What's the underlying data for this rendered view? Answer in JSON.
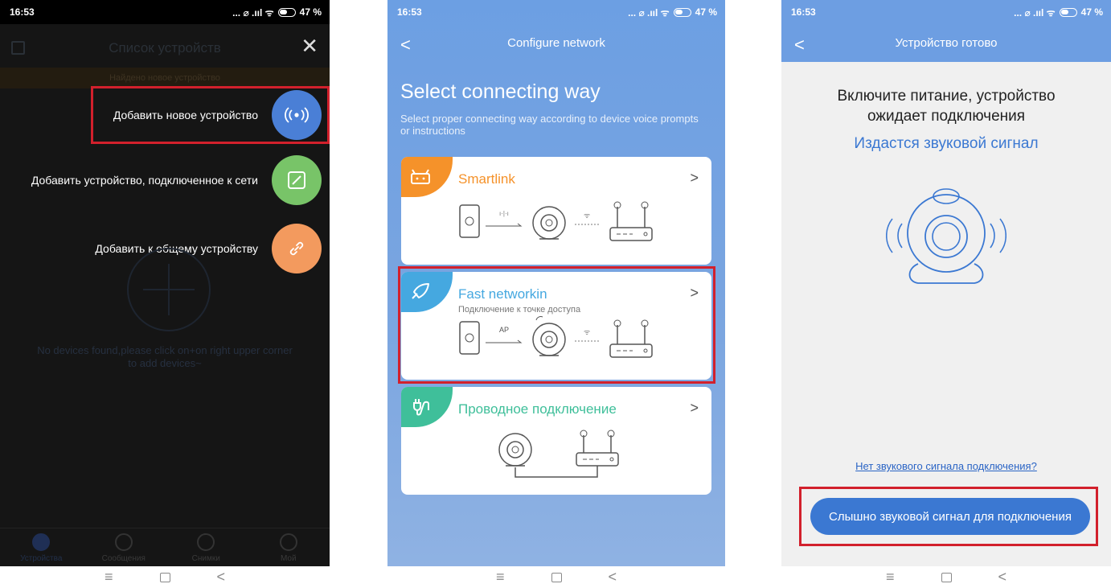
{
  "status": {
    "time": "16:53",
    "signal": "... ⌀ .ııl ᯤ",
    "battery": "47 %"
  },
  "screen1": {
    "title": "Список устройств",
    "found_bar": "Найдено новое устройство",
    "menu": [
      {
        "label": "Добавить новое устройство",
        "color": "#4a7fd6",
        "icon": "wireless-signal-icon"
      },
      {
        "label": "Добавить устройство, подключенное к сети",
        "color": "#78c468",
        "icon": "edit-square-icon"
      },
      {
        "label": "Добавить к общему устройству",
        "color": "#f39a5e",
        "icon": "link-icon"
      }
    ],
    "empty_text": "No devices found,please click on+on right upper corner to add devices~",
    "tabs": [
      "Устройства",
      "Сообщения",
      "Снимки",
      "Мой"
    ]
  },
  "screen2": {
    "title": "Configure network",
    "heading": "Select connecting way",
    "subheading": "Select proper connecting way according to device voice prompts or instructions",
    "cards": [
      {
        "title": "Smartlink",
        "subtitle": "",
        "accent": "#f5922a",
        "icon": "android-icon"
      },
      {
        "title": "Fast networkin",
        "subtitle": "Подключение к точке доступа",
        "accent": "#45a8e0",
        "icon": "rocket-icon",
        "ap_label": "AP"
      },
      {
        "title": "Проводное подключение",
        "subtitle": "",
        "accent": "#3fbf9a",
        "icon": "cable-plug-icon"
      }
    ]
  },
  "screen3": {
    "title": "Устройство готово",
    "line1": "Включите питание, устройство",
    "line2": "ожидает подключения",
    "line3": "Издастся звуковой сигнал",
    "no_signal_link": "Нет звукового сигнала подключения?",
    "confirm_button": "Слышно звуковой сигнал для подключения"
  },
  "nav": {
    "menu": "≡",
    "back": "<"
  }
}
